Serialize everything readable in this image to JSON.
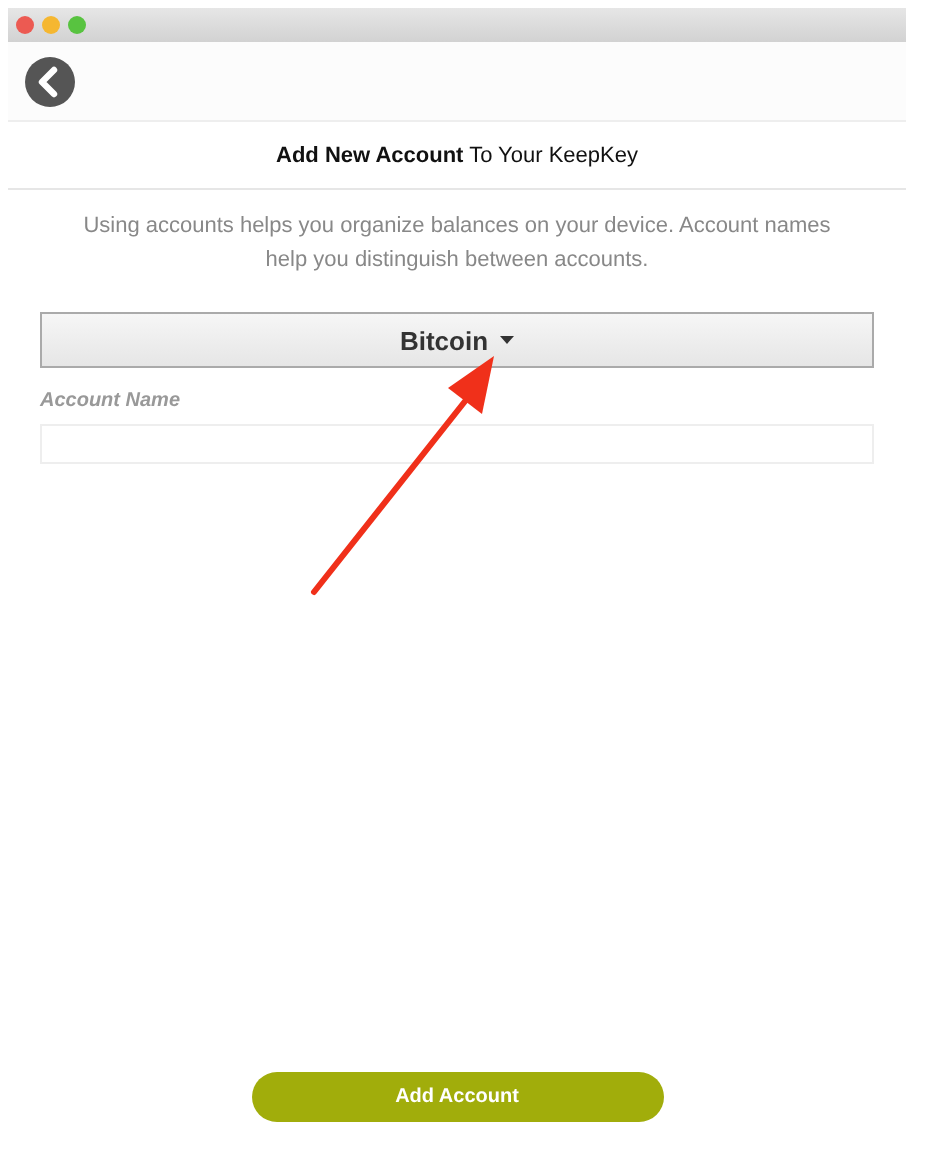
{
  "window": {
    "title": "**Add New Account** To Your KeepKey"
  },
  "description": "Using accounts helps you organize balances on your device. Account names help you distinguish between accounts.",
  "currency_dropdown": {
    "value": "Bitcoin"
  },
  "account_name": {
    "label": "Account Name"
  },
  "buttons": [
    "Add Account"
  ]
}
